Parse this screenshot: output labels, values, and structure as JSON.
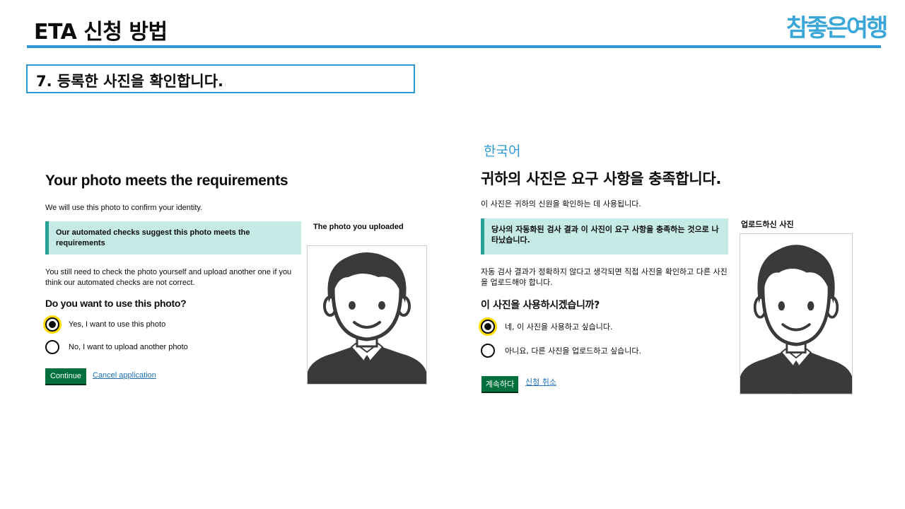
{
  "header": {
    "title": "ETA 신청 방법",
    "brand": "참좋은여행",
    "step": "7. 등록한 사진을 확인합니다."
  },
  "english_panel": {
    "heading": "Your photo meets the requirements",
    "intro": "We will use this photo to confirm your identity.",
    "inset": "Our automated checks suggest this photo meets the requirements",
    "note": "You still need to check the photo yourself and upload another one if you think our automated checks are not correct.",
    "question": "Do you want to use this photo?",
    "option_yes": "Yes, I want to use this photo",
    "option_no": "No, I want to upload another photo",
    "selected": "yes",
    "continue": "Continue",
    "cancel": "Cancel application",
    "photo_label": "The photo you uploaded"
  },
  "korean_panel": {
    "language_label": "한국어",
    "heading": "귀하의 사진은 요구 사항을 충족합니다.",
    "intro": "이 사진은 귀하의 신원을 확인하는 데 사용됩니다.",
    "inset": "당사의 자동화된 검사 결과 이 사진이 요구 사항을 충족하는 것으로 나타났습니다.",
    "note": "자동 검사 결과가 정확하지 않다고 생각되면 직접 사진을 확인하고 다른 사진을 업로드해야 합니다.",
    "question": "이 사진을 사용하시겠습니까?",
    "option_yes": "네, 이 사진을 사용하고 싶습니다.",
    "option_no": "아니요, 다른 사진을 업로드하고 싶습니다.",
    "selected": "yes",
    "continue": "계속하다",
    "cancel": "신청 취소",
    "photo_label": "업로드하신 사진"
  },
  "colors": {
    "accent_blue": "#2d9ad6",
    "govuk_green": "#00703c",
    "inset_bg": "#c6eae6",
    "inset_border": "#28a197",
    "link_blue": "#1d70b8",
    "focus_yellow": "#ffdd00"
  },
  "icons": {
    "avatar": "person-avatar-icon"
  }
}
